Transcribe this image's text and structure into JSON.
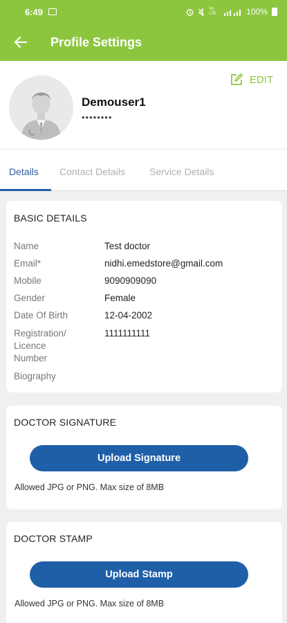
{
  "status_bar": {
    "time": "6:49",
    "battery": "100%",
    "network": "Vo LTE"
  },
  "app_bar": {
    "title": "Profile Settings",
    "back_icon": "arrow-left-icon"
  },
  "profile": {
    "username": "Demouser1",
    "password_mask": "••••••••",
    "edit_label": "EDIT",
    "edit_icon": "edit-icon"
  },
  "tabs": [
    {
      "label": "Details",
      "active": true
    },
    {
      "label": "Contact Details",
      "active": false
    },
    {
      "label": "Service Details",
      "active": false
    }
  ],
  "basic_details": {
    "title": "BASIC DETAILS",
    "rows": [
      {
        "label": "Name",
        "value": "Test  doctor"
      },
      {
        "label": "Email*",
        "value": "nidhi.emedstore@gmail.com"
      },
      {
        "label": "Mobile",
        "value": "9090909090"
      },
      {
        "label": "Gender",
        "value": "Female"
      },
      {
        "label": "Date Of Birth",
        "value": "12-04-2002"
      },
      {
        "label": "Registration/\nLicence\nNumber",
        "value": "1111111111"
      },
      {
        "label": "Biography",
        "value": ""
      }
    ]
  },
  "signature": {
    "title": "DOCTOR SIGNATURE",
    "button_label": "Upload Signature",
    "hint": "Allowed JPG or PNG. Max size of 8MB"
  },
  "stamp": {
    "title": "DOCTOR STAMP",
    "button_label": "Upload Stamp",
    "hint": "Allowed JPG or PNG. Max size of 8MB"
  },
  "colors": {
    "primary_green": "#8cc63f",
    "primary_blue": "#1f5fa8"
  }
}
